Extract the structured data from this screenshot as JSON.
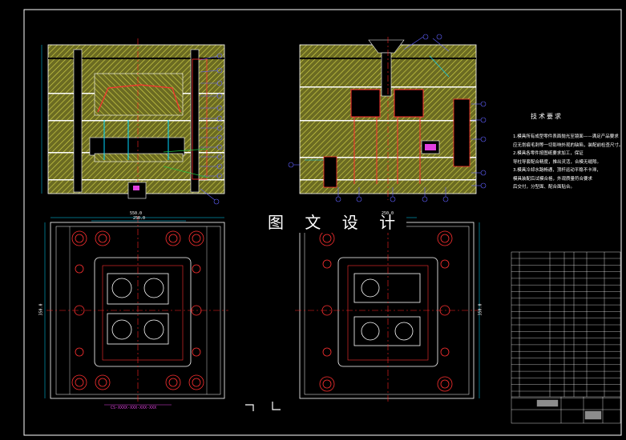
{
  "watermark": "图 文 设 计",
  "technical_requirements": {
    "title": "技术要求",
    "lines": [
      "1.模具所有成型零件表面抛光至镜面——满足产品要求",
      "应无划痕毛刺等一切影响外观的缺陷，装配前检查尺寸。",
      "2.模具各零件按图纸要求加工，保证",
      "导柱导套配合精度，推出灵活，合模无缝隙。",
      "3.模具冷却水路畅通，顶杆运动平稳不卡滞，",
      "模具装配后试模合格，外观质量符合要求",
      "后交付，分型面、配合面贴合。"
    ]
  },
  "dimension_labels": {
    "top_width": "550.0",
    "top_inner_width": "250.0",
    "right_top_width": "250.0",
    "left_height": "350.0",
    "right_height": "350.0"
  },
  "part_code": "CS-XXXX-XXX-XXX-XXX",
  "colors": {
    "background": "#000000",
    "outline": "#ffffff",
    "hatch": "#d8d84a",
    "plate_fill": "#6b6b22",
    "centerline": "#ff2020",
    "cyan": "#00d8ff",
    "magenta": "#e040e0",
    "balloon": "#6060ff",
    "green": "#20c040"
  }
}
